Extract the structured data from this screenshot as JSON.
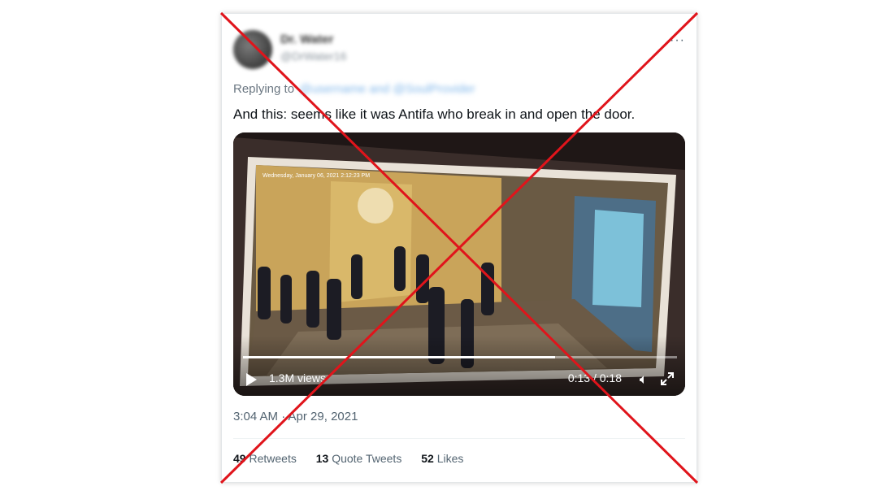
{
  "tweet": {
    "author_name": "Dr. Water",
    "author_handle": "@DrWater16",
    "more_icon": "more-horizontal-icon",
    "replying_label": "Replying to",
    "replying_handles": "@username and @SoulProvider",
    "text": "And this: seems like it was Antifa who break in and open the door.",
    "video": {
      "overlay_timestamp": "Wednesday, January 06, 2021 2:12:23 PM",
      "views": "1.3M views",
      "time": "0:13 / 0:18",
      "progress": 0.72,
      "play_icon": "play-icon",
      "volume_icon": "volume-icon",
      "expand_icon": "fullscreen-icon"
    },
    "timestamp": "3:04 AM · Apr 29, 2021",
    "stats": {
      "retweets_count": "49",
      "retweets_label": "Retweets",
      "quotes_count": "13",
      "quotes_label": "Quote Tweets",
      "likes_count": "52",
      "likes_label": "Likes"
    }
  },
  "overlay": {
    "mark": "red-x-cross",
    "color": "#e0141b"
  }
}
